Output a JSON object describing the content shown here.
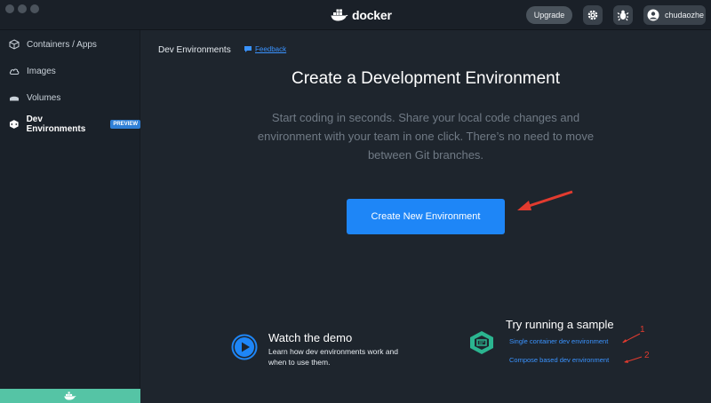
{
  "titlebar": {
    "app_name": "docker",
    "upgrade_label": "Upgrade",
    "user_name": "chudaozhe",
    "icons": [
      "settings-gear-icon",
      "bug-icon",
      "user-avatar-icon"
    ]
  },
  "sidebar": {
    "items": [
      {
        "label": "Containers / Apps",
        "icon": "containers-icon"
      },
      {
        "label": "Images",
        "icon": "cloud-icon"
      },
      {
        "label": "Volumes",
        "icon": "volume-icon"
      },
      {
        "label": "Dev Environments",
        "icon": "dev-env-icon",
        "badge": "PREVIEW",
        "active": true
      }
    ]
  },
  "main": {
    "breadcrumb": "Dev Environments",
    "feedback_label": "Feedback",
    "headline": "Create a Development Environment",
    "subtitle": "Start coding in seconds. Share your local code changes and environment with your team in one click. There’s no need to move between Git branches.",
    "cta_label": "Create New Environment",
    "demo": {
      "title": "Watch the demo",
      "description": "Learn how dev environments work and when to use them."
    },
    "sample": {
      "title": "Try running a sample",
      "links": [
        "Single container dev environment",
        "Compose based dev environment"
      ]
    },
    "annotations": [
      "1",
      "2"
    ]
  },
  "colors": {
    "accent": "#1e86f7",
    "link": "#3a93ff",
    "annotation": "#e23b2f",
    "whale_bar": "#55c4a5"
  }
}
